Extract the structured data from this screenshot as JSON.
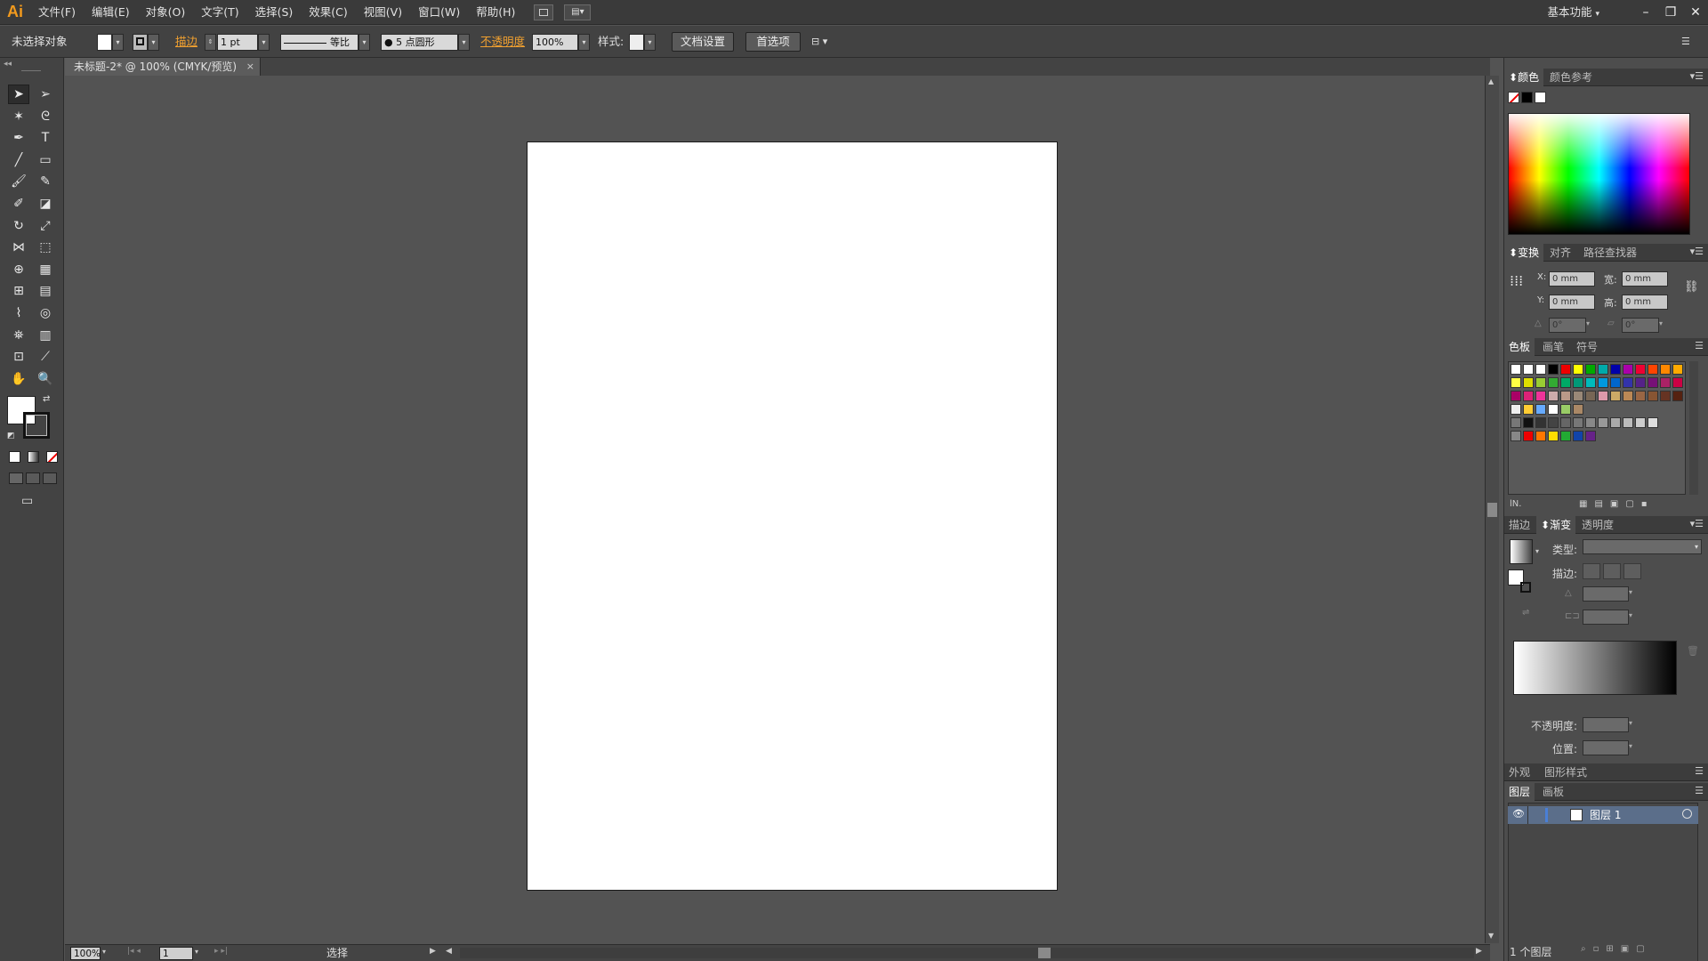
{
  "app": {
    "logo": "Ai",
    "menus": [
      "文件(F)",
      "编辑(E)",
      "对象(O)",
      "文字(T)",
      "选择(S)",
      "效果(C)",
      "视图(V)",
      "窗口(W)",
      "帮助(H)"
    ],
    "workspace": "基本功能",
    "window_controls": {
      "minimize": "–",
      "restore": "❐",
      "close": "✕"
    }
  },
  "control_bar": {
    "selection_status": "未选择对象",
    "stroke_label": "描边",
    "stroke_weight": "1 pt",
    "stroke_profile": "等比",
    "brush": "5 点圆形",
    "opacity_label": "不透明度",
    "opacity_value": "100%",
    "style_label": "样式:",
    "document_setup": "文档设置",
    "preferences": "首选项"
  },
  "document": {
    "tab_title": "未标题-2* @ 100% (CMYK/预览)",
    "close": "×"
  },
  "status_bar": {
    "zoom": "100%",
    "artboard_number": "1",
    "tool": "选择"
  },
  "tools": [
    "selection-tool",
    "direct-selection-tool",
    "magic-wand-tool",
    "lasso-tool",
    "pen-tool",
    "type-tool",
    "line-tool",
    "rectangle-tool",
    "paintbrush-tool",
    "pencil-tool",
    "blob-brush-tool",
    "eraser-tool",
    "rotate-tool",
    "scale-tool",
    "width-tool",
    "free-transform-tool",
    "shape-builder-tool",
    "perspective-grid-tool",
    "mesh-tool",
    "gradient-tool",
    "eyedropper-tool",
    "blend-tool",
    "symbol-sprayer-tool",
    "column-graph-tool",
    "artboard-tool",
    "slice-tool",
    "hand-tool",
    "zoom-tool"
  ],
  "panels": {
    "color": {
      "tabs": [
        "颜色",
        "颜色参考"
      ]
    },
    "transform": {
      "tabs": [
        "变换",
        "对齐",
        "路径查找器"
      ],
      "x_label": "X:",
      "y_label": "Y:",
      "w_label": "宽:",
      "h_label": "高:",
      "x": "0 mm",
      "y": "0 mm",
      "w": "0 mm",
      "h": "0 mm",
      "rotate": "0°",
      "shear": "0°"
    },
    "swatches": {
      "tabs": [
        "色板",
        "画笔",
        "符号"
      ]
    },
    "gradient": {
      "tabs": [
        "描边",
        "渐变",
        "透明度"
      ],
      "type_label": "类型:",
      "stroke_label": "描边:",
      "opacity_label": "不透明度:",
      "location_label": "位置:"
    },
    "appearance": {
      "tabs": [
        "外观",
        "图形样式"
      ]
    },
    "layers": {
      "tabs": [
        "图层",
        "画板"
      ],
      "layer_name": "图层 1",
      "count": "1 个图层"
    }
  },
  "colors": {
    "menubar": "#3a3a3a",
    "panel": "#4d4d4d",
    "canvas": "#535353",
    "artboard": "#ffffff",
    "accent_orange": "#f0a030",
    "layer_highlight": "#5b6e8a"
  }
}
